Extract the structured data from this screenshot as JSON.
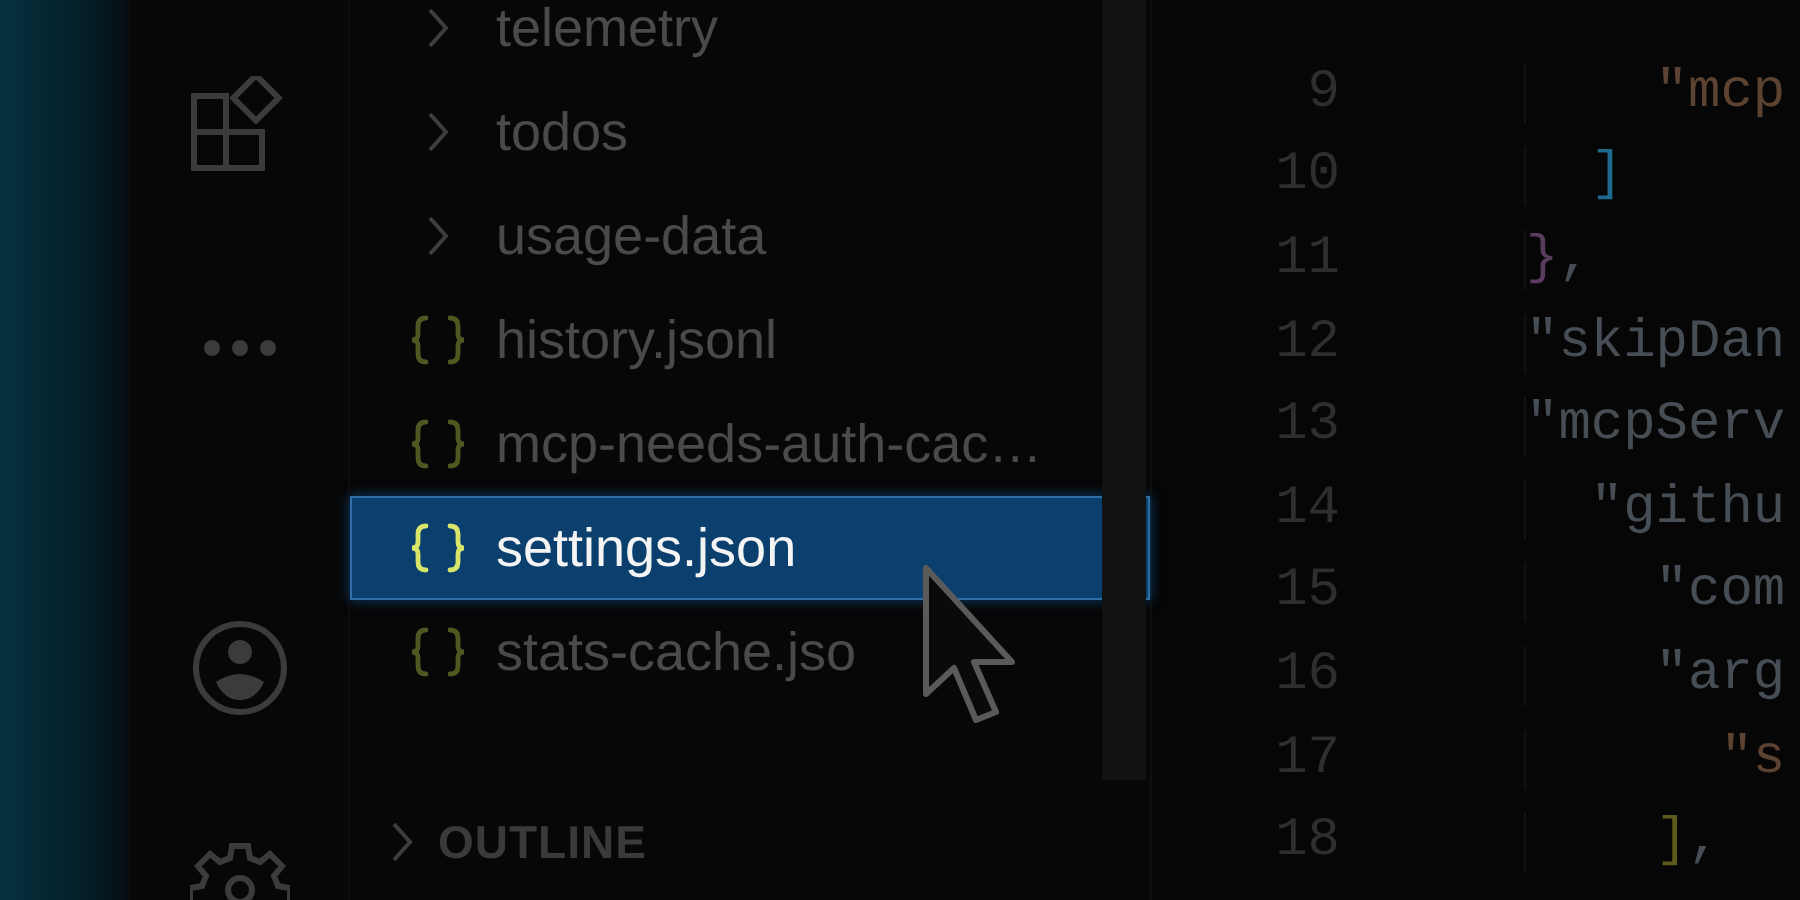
{
  "activity_bar": {
    "items": [
      {
        "kind": "extensions"
      },
      {
        "kind": "more"
      },
      {
        "kind": "account"
      },
      {
        "kind": "settings"
      }
    ]
  },
  "explorer": {
    "items": [
      {
        "name": "telemetry",
        "kind": "folder",
        "selected": false
      },
      {
        "name": "todos",
        "kind": "folder",
        "selected": false
      },
      {
        "name": "usage-data",
        "kind": "folder",
        "selected": false
      },
      {
        "name": "history.jsonl",
        "kind": "json",
        "selected": false
      },
      {
        "name": "mcp-needs-auth-cac…",
        "kind": "json",
        "selected": false
      },
      {
        "name": "settings.json",
        "kind": "json",
        "selected": true
      },
      {
        "name": "stats-cache.jso",
        "kind": "json",
        "selected": false
      }
    ],
    "outline": {
      "label": "OUTLINE",
      "expanded": false
    }
  },
  "editor": {
    "lines": [
      {
        "number": "9",
        "tokens": [
          {
            "text": "    \"mcp",
            "kind": "string"
          }
        ]
      },
      {
        "number": "10",
        "tokens": [
          {
            "text": "  ]",
            "kind": "bracket",
            "color": "#1f6a8c"
          }
        ]
      },
      {
        "number": "11",
        "tokens": [
          {
            "text": "}",
            "kind": "bracket",
            "color": "#5a3c5e"
          },
          {
            "text": ",",
            "kind": "punct"
          }
        ]
      },
      {
        "number": "12",
        "tokens": [
          {
            "text": "\"skipDan",
            "kind": "key"
          }
        ]
      },
      {
        "number": "13",
        "tokens": [
          {
            "text": "\"mcpServ",
            "kind": "key"
          }
        ]
      },
      {
        "number": "14",
        "tokens": [
          {
            "text": "  \"githu",
            "kind": "key"
          }
        ]
      },
      {
        "number": "15",
        "tokens": [
          {
            "text": "    \"com",
            "kind": "key"
          }
        ]
      },
      {
        "number": "16",
        "tokens": [
          {
            "text": "    \"arg",
            "kind": "key"
          }
        ]
      },
      {
        "number": "17",
        "tokens": [
          {
            "text": "      \"s",
            "kind": "string"
          }
        ]
      },
      {
        "number": "18",
        "tokens": [
          {
            "text": "    ]",
            "kind": "bracket",
            "color": "#5e5a1c"
          },
          {
            "text": ",",
            "kind": "punct"
          }
        ]
      }
    ]
  }
}
